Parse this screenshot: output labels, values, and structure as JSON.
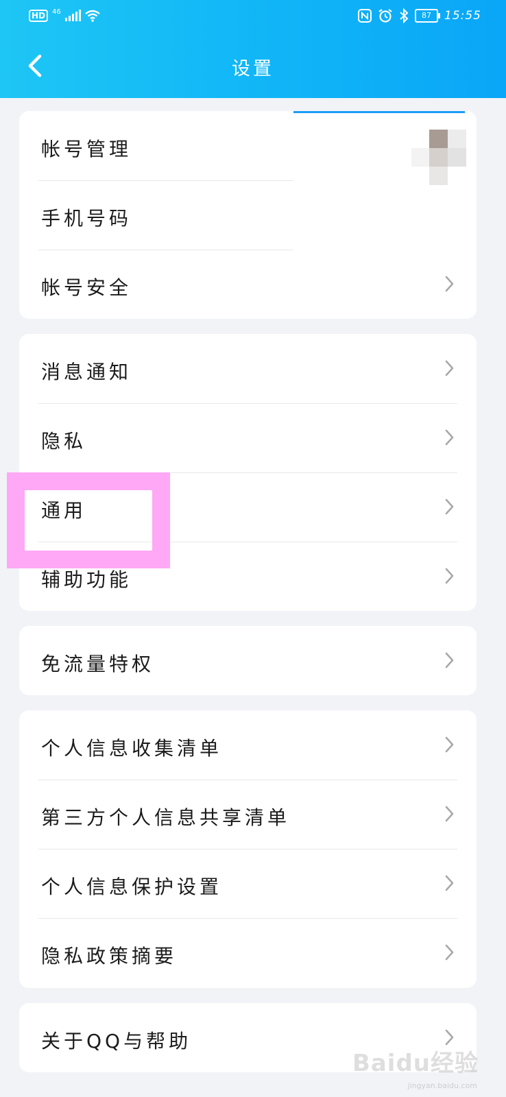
{
  "status_bar": {
    "hd": "HD",
    "network": "46",
    "battery": "87",
    "time": "15:55",
    "icons": [
      "nfc-icon",
      "alarm-icon",
      "bluetooth-icon",
      "wifi-icon",
      "signal-icon"
    ]
  },
  "header": {
    "title": "设置",
    "back_icon": "chevron-left-icon"
  },
  "sections": {
    "account": {
      "item0": "帐号管理",
      "item1": "手机号码",
      "item2": "帐号安全"
    },
    "general": {
      "item0": "消息通知",
      "item1": "隐私",
      "item2": "通用",
      "item3": "辅助功能"
    },
    "traffic": {
      "item0": "免流量特权"
    },
    "personal": {
      "item0": "个人信息收集清单",
      "item1": "第三方个人信息共享清单",
      "item2": "个人信息保护设置",
      "item3": "隐私政策摘要"
    },
    "about": {
      "item0": "关于QQ与帮助"
    }
  },
  "watermark": {
    "text": "Baidu经验",
    "sub": "jingyan.baidu.com"
  },
  "colors": {
    "header_start": "#1ec6f5",
    "header_end": "#0aa6f7",
    "background": "#f1f3f7",
    "highlight": "#ffa8f5"
  }
}
